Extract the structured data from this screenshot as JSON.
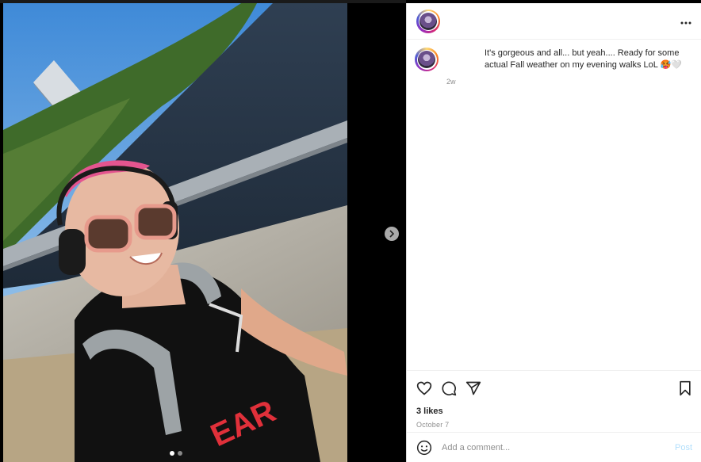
{
  "post": {
    "caption": "It's gorgeous and all... but yeah.... Ready for some actual Fall weather on my evening walks LoL 🥵🤍",
    "caption_time": "2w",
    "likes": "3 likes",
    "date": "October 7"
  },
  "carousel": {
    "total": 2,
    "current": 1
  },
  "comment": {
    "placeholder": "Add a comment...",
    "post_label": "Post"
  },
  "icons": {
    "more": "more-options-icon",
    "like": "heart-icon",
    "comment": "comment-icon",
    "share": "share-icon",
    "save": "bookmark-icon",
    "emoji": "emoji-icon",
    "next": "chevron-right-icon"
  },
  "colors": {
    "link_disabled": "#b2dffc",
    "muted_text": "#8e8e8e",
    "text": "#262626"
  }
}
